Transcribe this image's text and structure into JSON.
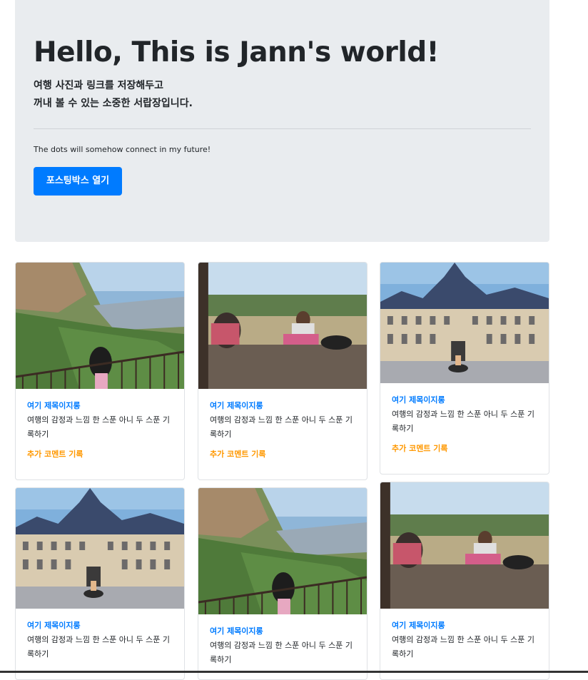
{
  "jumbotron": {
    "title": "Hello, This is Jann's world!",
    "lead_line1": "여행 사진과 링크를 저장해두고",
    "lead_line2": "꺼내 볼 수 있는 소중한 서랍장입니다.",
    "motto": "The dots will somehow connect in my future!",
    "button_label": "포스팅박스 열기"
  },
  "cards": [
    {
      "photo": "mountain-photo",
      "title": "여기 제목이지롱",
      "text": "여행의 감정과 느낌 한 스푼 아니 두 스푼 기록하기",
      "link": "추가 코멘트 기록"
    },
    {
      "photo": "park-photo",
      "title": "여기 제목이지롱",
      "text": "여행의 감정과 느낌 한 스푼 아니 두 스푼 기록하기",
      "link": "추가 코멘트 기록"
    },
    {
      "photo": "city-hall-photo",
      "title": "여기 제목이지롱",
      "text": "여행의 감정과 느낌 한 스푼 아니 두 스푼 기록하기",
      "link": "추가 코멘트 기록"
    },
    {
      "photo": "city-hall-photo",
      "title": "여기 제목이지롱",
      "text": "여행의 감정과 느낌 한 스푼 아니 두 스푼 기록하기"
    },
    {
      "photo": "mountain-photo",
      "title": "여기 제목이지롱",
      "text": "여행의 감정과 느낌 한 스푼 아니 두 스푼 기록하기"
    },
    {
      "photo": "park-photo",
      "title": "여기 제목이지롱",
      "text": "여행의 감정과 느낌 한 스푼 아니 두 스푼 기록하기"
    }
  ],
  "colors": {
    "primary": "#007bff",
    "accent": "#ff9800",
    "jumbotron_bg": "#e9ecef"
  }
}
